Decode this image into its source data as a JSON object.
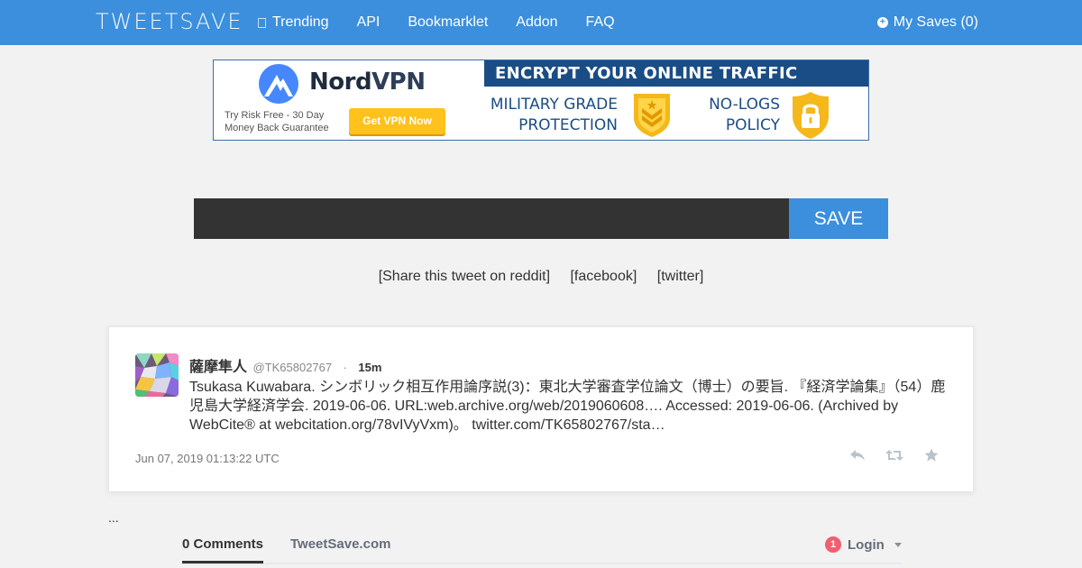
{
  "navbar": {
    "brand": "TWEETSAVE",
    "links": [
      "Trending",
      "API",
      "Bookmarklet",
      "Addon",
      "FAQ"
    ],
    "my_saves": "My Saves (0)",
    "colors": {
      "bar": "#3b8fdc",
      "text": "#ffffff"
    }
  },
  "ad": {
    "brand_prefix": "Nord",
    "brand_suffix": "VPN",
    "risk_text": "Try Risk Free - 30 Day Money Back Guarantee",
    "cta": "Get VPN Now",
    "headline": "ENCRYPT YOUR ONLINE TRAFFIC",
    "feature1": "MILITARY GRADE PROTECTION",
    "feature2": "NO-LOGS POLICY",
    "colors": {
      "navy": "#1a4d86",
      "yellow": "#ffc21c",
      "logo_blue": "#4687ff"
    }
  },
  "search": {
    "value": "",
    "placeholder": "",
    "save_label": "SAVE"
  },
  "share": {
    "reddit": "[Share this tweet on reddit]",
    "facebook": "[facebook]",
    "twitter": "[twitter]"
  },
  "tweet": {
    "name": "薩摩隼人",
    "handle": "@TK65802767",
    "separator": "·",
    "age": "15m",
    "text": "Tsukasa Kuwabara. シンボリック相互作用論序説(3)：東北大学審査学位論文（博士）の要旨. 『経済学論集』（54）鹿児島大学経済学会. 2019-06-06. URL:web.archive.org/web/2019060608…. Accessed: 2019-06-06. (Archived by WebCite® at webcitation.org/78vIVyVxm)。 twitter.com/TK65802767/sta…",
    "date": "Jun 07, 2019 01:13:22 UTC",
    "actions": [
      "reply-icon",
      "retweet-icon",
      "favorite-icon"
    ]
  },
  "ellipsis": "...",
  "comments": {
    "count_tab": "0 Comments",
    "site_tab": "TweetSave.com",
    "login_badge": "1",
    "login_label": "Login"
  }
}
